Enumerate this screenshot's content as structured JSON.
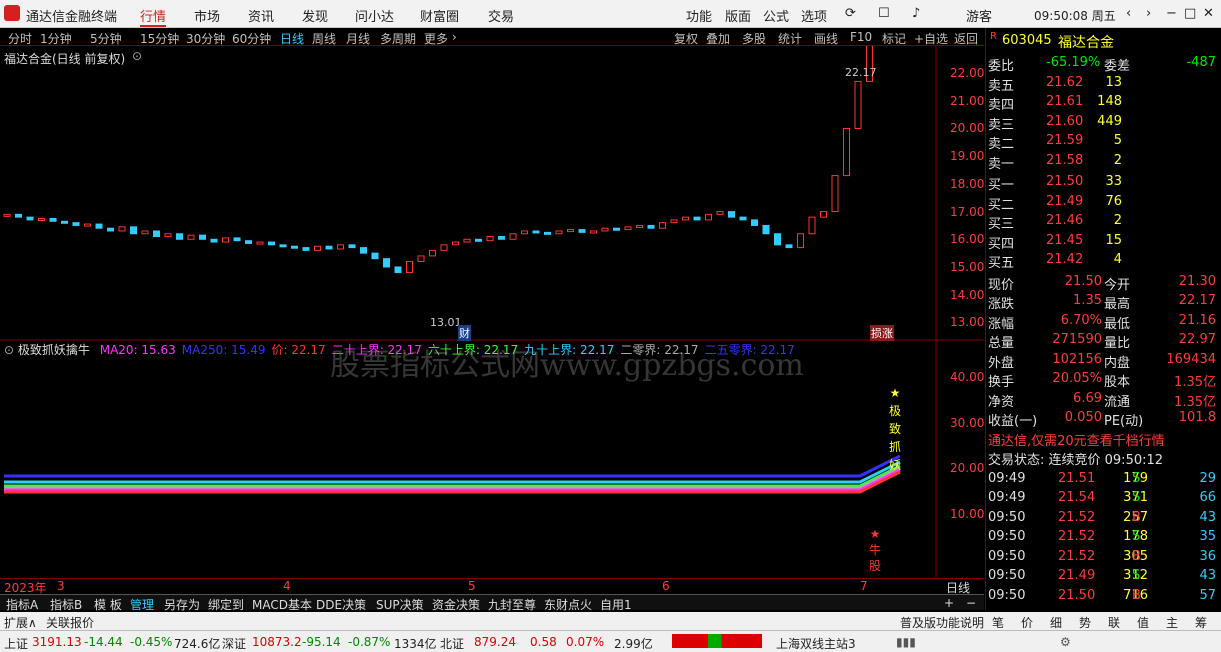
{
  "app": {
    "title": "通达信金融终端",
    "menu": [
      "行情",
      "市场",
      "资讯",
      "发现",
      "问小达",
      "财富圈",
      "交易"
    ],
    "right_menu": [
      "功能",
      "版面",
      "公式",
      "选项"
    ],
    "user": "游客",
    "clock": "09:50:08 周五"
  },
  "periods": [
    "分时",
    "1分钟",
    "5分钟",
    "15分钟",
    "30分钟",
    "60分钟",
    "日线",
    "周线",
    "月线",
    "多周期",
    "更多"
  ],
  "tools": [
    "复权",
    "叠加",
    "多股",
    "统计",
    "画线",
    "F10",
    "标记",
    "+自选",
    "返回"
  ],
  "chart": {
    "title": "福达合金(日线 前复权)",
    "price_ticks": [
      "22.00",
      "21.00",
      "20.00",
      "19.00",
      "18.00",
      "17.00",
      "16.00",
      "15.00",
      "14.00",
      "13.00"
    ],
    "high_label": "22.17",
    "low_label": "13.01",
    "cai_tag": "财",
    "limit_tag": "损涨",
    "watermark": "股票指标公式网www.gpzbgs.com"
  },
  "indicator": {
    "name": "极致抓妖擒牛",
    "items": [
      {
        "label": "MA20: 15.63",
        "color": "#ff33ff"
      },
      {
        "label": "MA250: 15.49",
        "color": "#3333ff"
      },
      {
        "label": "价: 22.17",
        "color": "#ff3333"
      },
      {
        "label": "二十上界: 22.17",
        "color": "#ff33ff"
      },
      {
        "label": "六十上界: 22.17",
        "color": "#33ff33"
      },
      {
        "label": "九十上界: 22.17",
        "color": "#33ccff"
      },
      {
        "label": "二零界: 22.17",
        "color": "#aaaaaa"
      },
      {
        "label": "二五零界: 22.17",
        "color": "#3333ff"
      }
    ],
    "ticks": [
      "40.00",
      "30.00",
      "20.00",
      "10.00"
    ],
    "vert_label": [
      "极",
      "致",
      "抓",
      "妖"
    ],
    "bull_label": [
      "牛",
      "股"
    ]
  },
  "xaxis": {
    "labels": [
      "2023年",
      "3",
      "4",
      "5",
      "6",
      "7"
    ],
    "period": "日线"
  },
  "bottom_tabs": [
    "指标A",
    "指标B",
    "模 板",
    "管理",
    "另存为",
    "绑定到",
    "MACD基本",
    "DDE决策",
    "SUP决策",
    "资金决策",
    "九封至尊",
    "东财点火",
    "自用1"
  ],
  "quote": {
    "code": "603045",
    "name": "福达合金",
    "wb_label": "委比",
    "wb": "-65.19%",
    "wc_label": "委差",
    "wc": "-487",
    "sell": [
      {
        "l": "卖五",
        "p": "21.62",
        "v": "13"
      },
      {
        "l": "卖四",
        "p": "21.61",
        "v": "148"
      },
      {
        "l": "卖三",
        "p": "21.60",
        "v": "449"
      },
      {
        "l": "卖二",
        "p": "21.59",
        "v": "5"
      },
      {
        "l": "卖一",
        "p": "21.58",
        "v": "2"
      }
    ],
    "buy": [
      {
        "l": "买一",
        "p": "21.50",
        "v": "33"
      },
      {
        "l": "买二",
        "p": "21.49",
        "v": "76"
      },
      {
        "l": "买三",
        "p": "21.46",
        "v": "2"
      },
      {
        "l": "买四",
        "p": "21.45",
        "v": "15"
      },
      {
        "l": "买五",
        "p": "21.42",
        "v": "4"
      }
    ],
    "stats": [
      [
        "现价",
        "21.50",
        "今开",
        "21.30"
      ],
      [
        "涨跌",
        "1.35",
        "最高",
        "22.17"
      ],
      [
        "涨幅",
        "6.70%",
        "最低",
        "21.16"
      ],
      [
        "总量",
        "271590",
        "量比",
        "22.97"
      ],
      [
        "外盘",
        "102156",
        "内盘",
        "169434"
      ],
      [
        "换手",
        "20.05%",
        "股本",
        "1.35亿"
      ],
      [
        "净资",
        "6.69",
        "流通",
        "1.35亿"
      ],
      [
        "收益(一)",
        "0.050",
        "PE(动)",
        "101.8"
      ]
    ],
    "promo": "通达信,仅需20元查看千档行情",
    "state": "交易状态: 连续竞价 09:50:12",
    "ticks": [
      [
        "09:49",
        "21.51",
        "179",
        "S",
        "29"
      ],
      [
        "09:49",
        "21.54",
        "371",
        "S",
        "66"
      ],
      [
        "09:50",
        "21.52",
        "257",
        "B",
        "43"
      ],
      [
        "09:50",
        "21.52",
        "178",
        "S",
        "35"
      ],
      [
        "09:50",
        "21.52",
        "305",
        "B",
        "36"
      ],
      [
        "09:50",
        "21.49",
        "312",
        "S",
        "43"
      ],
      [
        "09:50",
        "21.50",
        "716",
        "B",
        "57"
      ]
    ],
    "tabs": [
      "笔",
      "价",
      "细",
      "势",
      "联",
      "值",
      "主",
      "筹"
    ]
  },
  "subbar": {
    "left": [
      "扩展∧",
      "关联报价"
    ],
    "right": "普及版功能说明"
  },
  "status": {
    "sh": "上证",
    "sh_v": "3191.13",
    "sh_c": "-14.44",
    "sh_p": "-0.45%",
    "sh_a": "724.6亿",
    "sz": "深证",
    "sz_v": "10873.2",
    "sz_c": "-95.14",
    "sz_p": "-0.87%",
    "sz_a": "1334亿",
    "bz": "北证",
    "bz_v": "879.24",
    "bz_c": "0.58",
    "bz_p": "0.07%",
    "bz_a": "2.99亿",
    "server": "上海双线主站3"
  }
}
